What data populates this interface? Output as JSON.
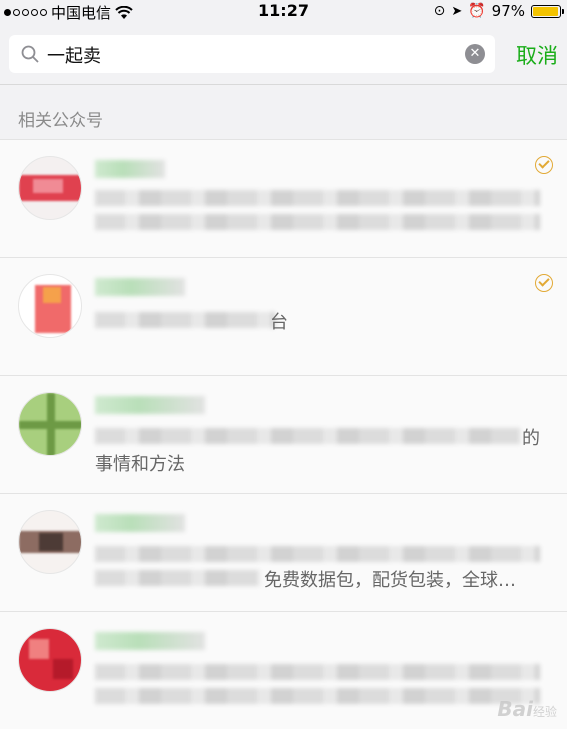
{
  "status_bar": {
    "carrier": "中国电信",
    "time": "11:27",
    "battery": "97%",
    "signal_icon": "signal-dots-icon",
    "wifi_icon": "wifi-icon",
    "battery_level": 0.97
  },
  "search": {
    "query": "一起卖",
    "cancel_label": "取消"
  },
  "section": {
    "title": "相关公众号"
  },
  "results": [
    {
      "verified": true,
      "visible_text": ""
    },
    {
      "verified": true,
      "visible_text": "台"
    },
    {
      "verified": false,
      "visible_text": "的",
      "second_line": "事情和方法"
    },
    {
      "verified": false,
      "visible_text": "",
      "second_line_tail": "免费数据包，配货包装，全球…"
    },
    {
      "verified": false,
      "visible_text": ""
    }
  ],
  "watermark": {
    "text": "Bai",
    "suffix": "经验"
  },
  "colors": {
    "accent_green": "#1aad19",
    "verified_gold": "#e2a935",
    "background": "#f2f2f4"
  }
}
